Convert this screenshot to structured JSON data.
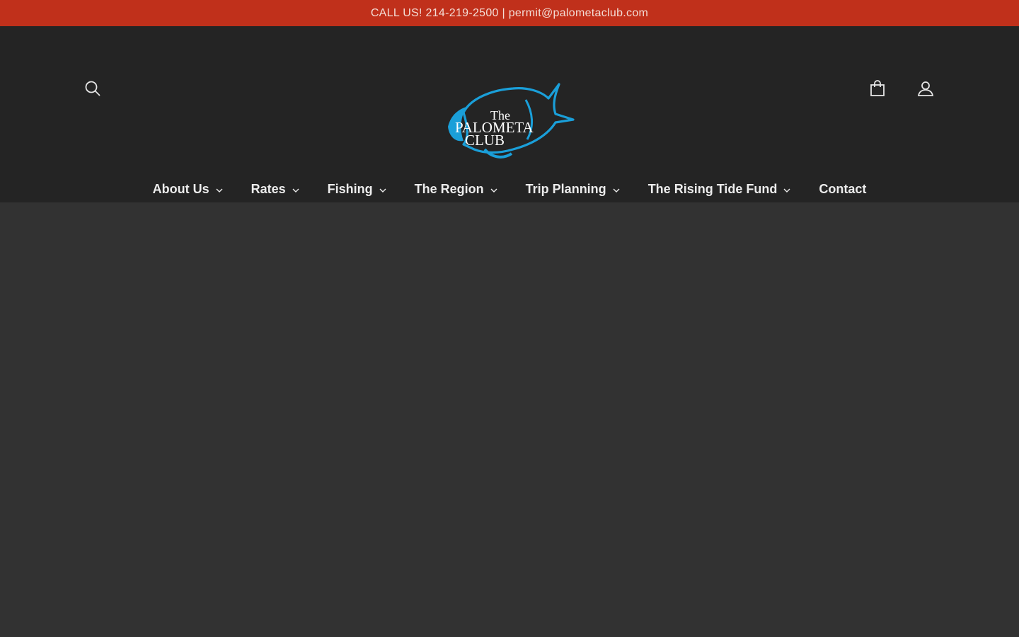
{
  "announcement": {
    "text": "CALL US! 214-219-2500 | permit@palometaclub.com"
  },
  "header": {
    "logo": {
      "line1": "The",
      "line2": "PALOMETA",
      "line3": "CLUB",
      "fish_color": "#1a9fd9",
      "text_color": "#ffffff"
    },
    "icons": {
      "search": "search-icon",
      "cart": "shopping-bag-icon",
      "account": "user-icon"
    }
  },
  "nav": {
    "items": [
      {
        "label": "About Us",
        "dropdown": true
      },
      {
        "label": "Rates",
        "dropdown": true
      },
      {
        "label": "Fishing",
        "dropdown": true
      },
      {
        "label": "The Region",
        "dropdown": true
      },
      {
        "label": "Trip Planning",
        "dropdown": true
      },
      {
        "label": "The Rising Tide Fund",
        "dropdown": true
      },
      {
        "label": "Contact",
        "dropdown": false
      }
    ]
  },
  "colors": {
    "announcement_bg": "#c0301b",
    "header_bg": "#242424",
    "body_bg": "#323232",
    "accent": "#1a9fd9"
  }
}
